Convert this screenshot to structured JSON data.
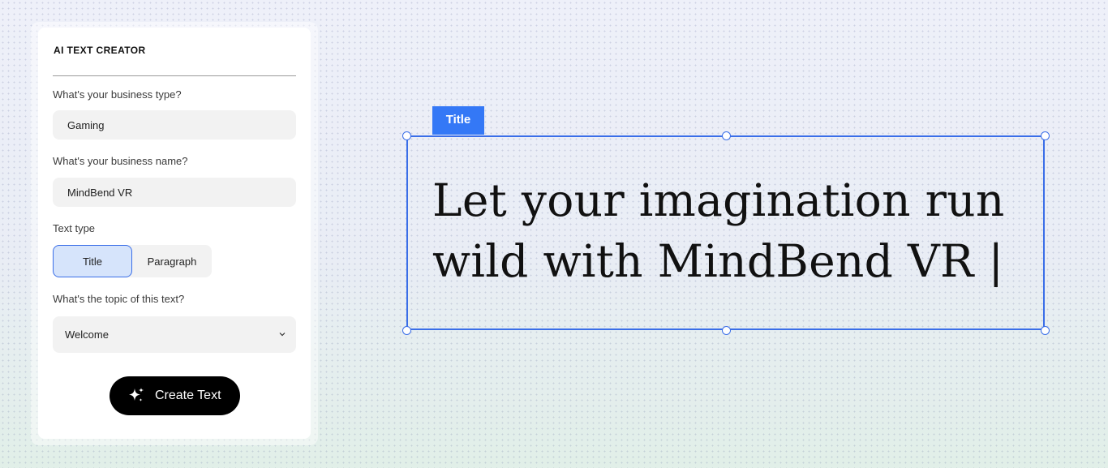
{
  "panel": {
    "title": "AI TEXT CREATOR",
    "business_type": {
      "label": "What's your business type?",
      "value": "Gaming"
    },
    "business_name": {
      "label": "What's your business name?",
      "value": "MindBend VR"
    },
    "text_type": {
      "label": "Text type",
      "options": [
        "Title",
        "Paragraph"
      ],
      "selected": "Title"
    },
    "topic": {
      "label": "What's the topic of this text?",
      "value": "Welcome"
    },
    "create_button": "Create Text"
  },
  "canvas": {
    "tag_label": "Title",
    "headline": "Let your imagination run wild with MindBend VR |"
  },
  "colors": {
    "accent": "#3478f6",
    "selected_bg": "#d6e4fb",
    "button_bg": "#000000"
  }
}
